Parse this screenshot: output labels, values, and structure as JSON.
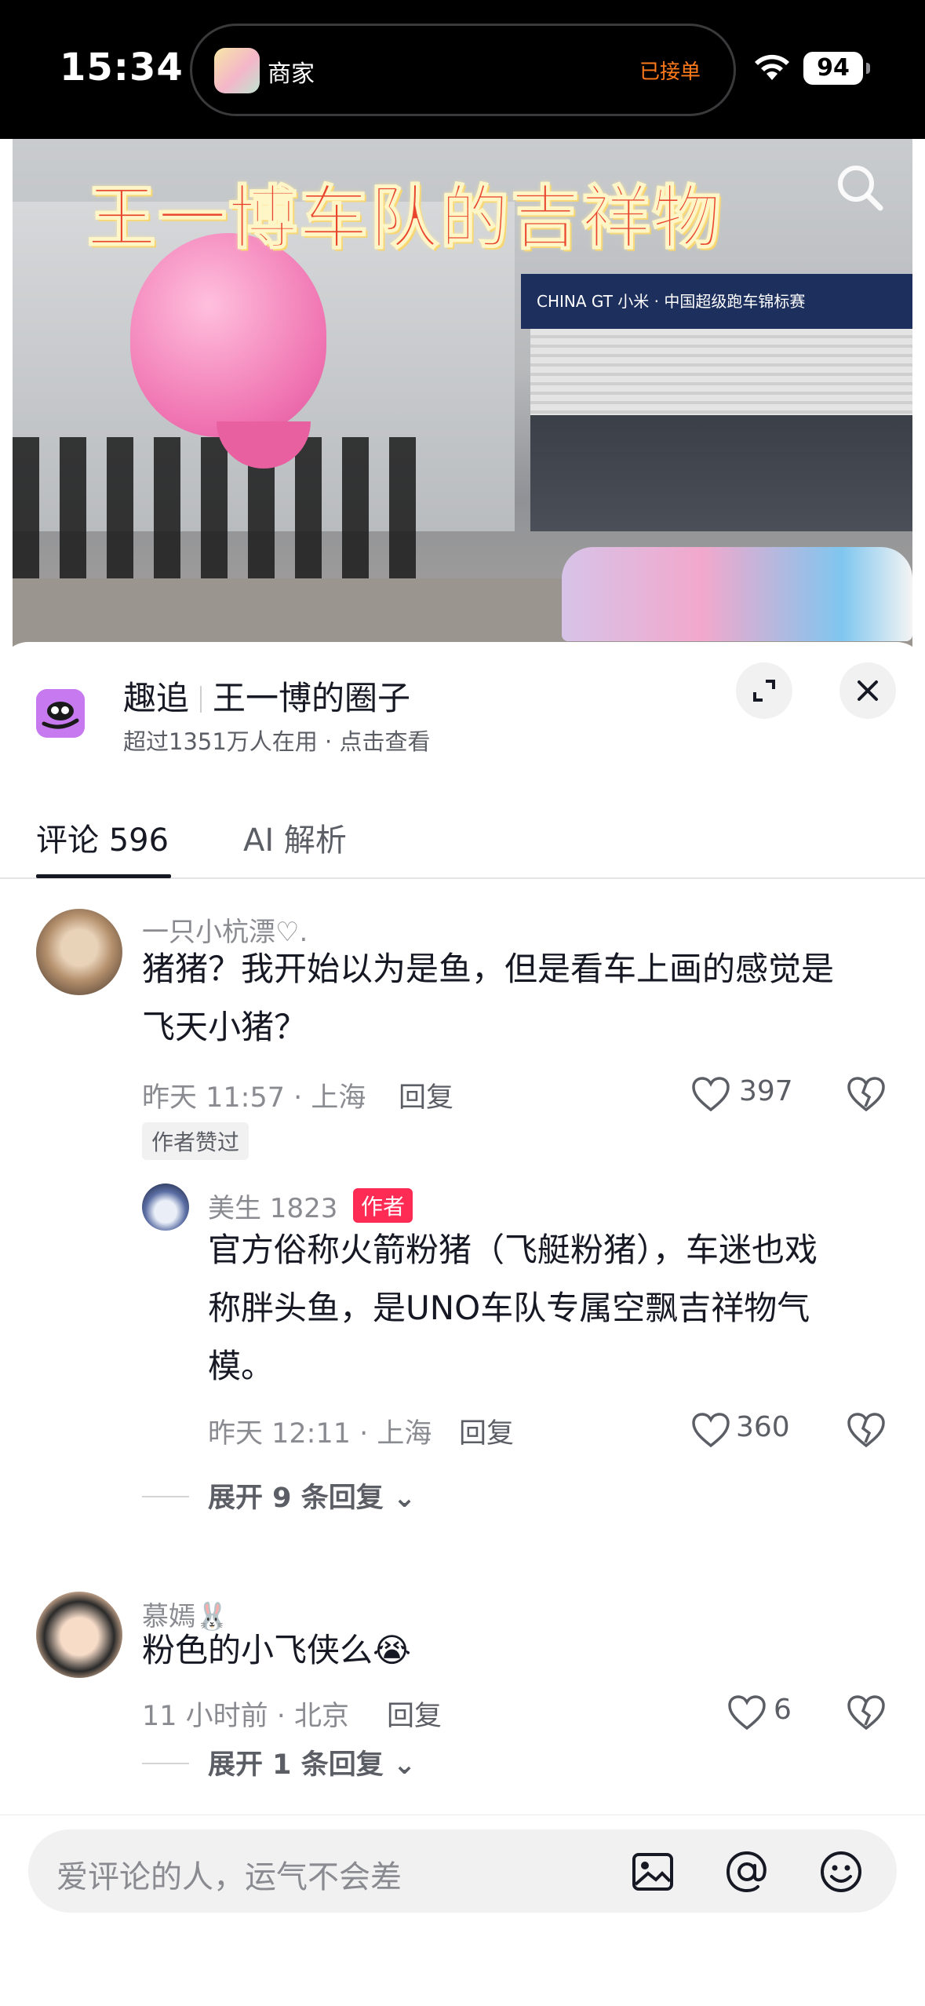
{
  "status_bar": {
    "time": "15:34",
    "island_label": "商家",
    "island_status": "已接单",
    "battery": "94"
  },
  "video": {
    "title": "王一博车队的吉祥物",
    "banner_text": "CHINA GT  小米 · 中国超级跑车锦标赛"
  },
  "circle": {
    "name": "趣追",
    "topic": "王一博的圈子",
    "subtitle": "超过1351万人在用 · 点击查看"
  },
  "tabs": [
    {
      "label": "评论 596",
      "active": true
    },
    {
      "label": "AI 解析",
      "active": false
    }
  ],
  "comments": [
    {
      "username": "一只小杭漂♡.",
      "text_line1": "猪猪？我开始以为是鱼，但是看车上画的感觉是",
      "text_line2": "飞天小猪？",
      "time": "昨天 11:57 · 上海",
      "reply_label": "回复",
      "likes": "397",
      "author_liked": "作者赞过",
      "reply": {
        "username": "美生 1823",
        "badge": "作者",
        "text_line1": "官方俗称火箭粉猪（飞艇粉猪），车迷也戏",
        "text_line2": "称胖头鱼，是UNO车队专属空飘吉祥物气",
        "text_line3": "模。",
        "time": "昨天 12:11 · 上海",
        "reply_label": "回复",
        "likes": "360"
      },
      "expand_label": "展开 9 条回复"
    },
    {
      "username": "慕嫣🐰",
      "text_line1": "粉色的小飞侠么😭",
      "time": "11 小时前 · 北京",
      "reply_label": "回复",
      "likes": "6",
      "expand_label": "展开 1 条回复"
    }
  ],
  "input": {
    "placeholder": "爱评论的人，运气不会差"
  },
  "icons": {
    "search": "search-icon",
    "expand": "expand-icon",
    "close": "close-icon",
    "like": "heart-icon",
    "dislike": "broken-heart-icon",
    "image": "image-icon",
    "mention": "at-icon",
    "emoji": "emoji-icon"
  },
  "colors": {
    "accent_red": "#fe2c55",
    "island_status": "#ff7a1a",
    "title_red": "#e8452c",
    "logo_purple": "#c77af0"
  }
}
